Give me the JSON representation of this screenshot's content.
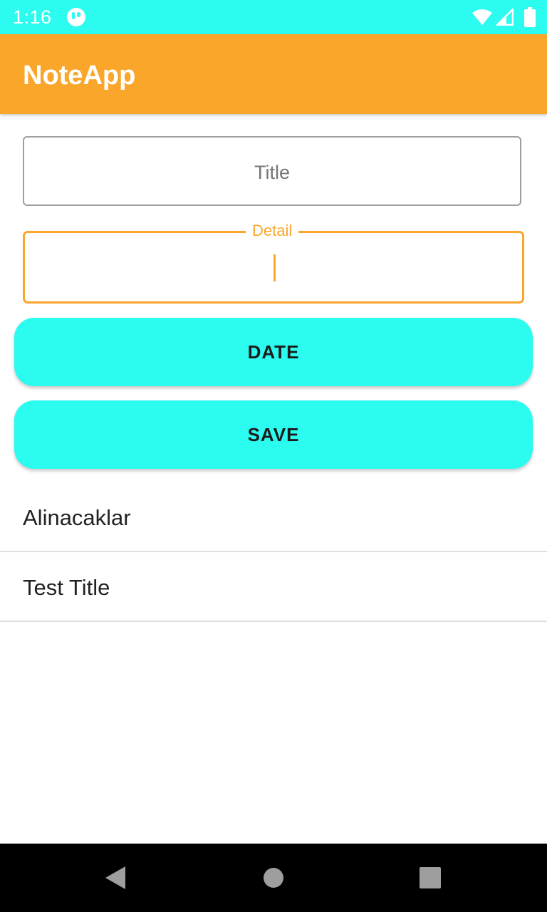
{
  "status_bar": {
    "time": "1:16",
    "app_icon": "app-notification-icon",
    "wifi_icon": "wifi-icon",
    "signal_icon": "cell-signal-icon",
    "battery_icon": "battery-icon",
    "color": "#2cfbf0"
  },
  "app_bar": {
    "title": "NoteApp",
    "color": "#f9a62b"
  },
  "form": {
    "title_placeholder": "Title",
    "title_value": "",
    "detail_label": "Detail",
    "detail_value": ""
  },
  "buttons": {
    "date_label": "DATE",
    "save_label": "SAVE",
    "color": "#2cfbf0"
  },
  "notes": [
    {
      "title": "Alinacaklar"
    },
    {
      "title": "Test Title"
    }
  ],
  "nav_bar": {
    "back_icon": "back-icon",
    "home_icon": "home-icon",
    "recents_icon": "recents-icon"
  }
}
